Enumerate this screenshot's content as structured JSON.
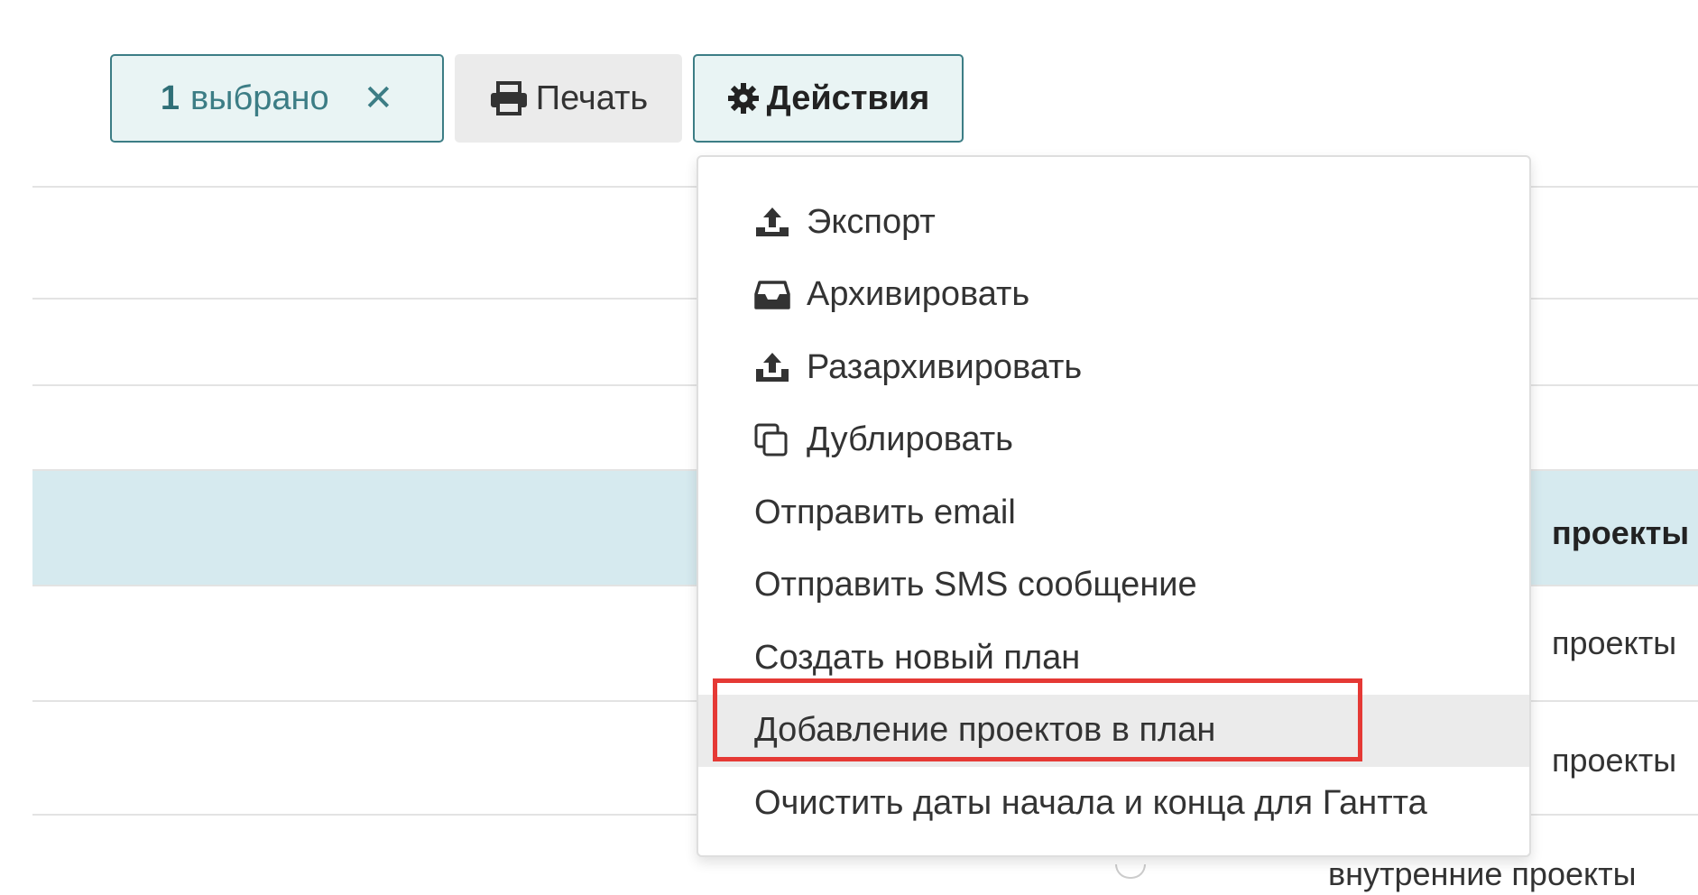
{
  "toolbar": {
    "selected_count": "1",
    "selected_label": "выбрано",
    "clear_glyph": "✕",
    "print_label": "Печать",
    "actions_label": "Действия",
    "accent_color": "#3c7d85"
  },
  "table": {
    "visible_cells": [
      "проекты",
      "проекты",
      "проекты",
      "внутренние проекты"
    ]
  },
  "actions_menu": {
    "items": [
      {
        "label": "Экспорт",
        "icon": "upload-tray-icon"
      },
      {
        "label": "Архивировать",
        "icon": "inbox-icon"
      },
      {
        "label": "Разархивировать",
        "icon": "upload-tray-icon"
      },
      {
        "label": "Дублировать",
        "icon": "copy-icon"
      },
      {
        "label": "Отправить email",
        "icon": ""
      },
      {
        "label": "Отправить SMS сообщение",
        "icon": ""
      },
      {
        "label": "Создать новый план",
        "icon": ""
      },
      {
        "label": "Добавление проектов в план",
        "icon": "",
        "hovered": true
      },
      {
        "label": "Очистить даты начала и конца для Гантта",
        "icon": ""
      }
    ],
    "annotation_color": "#e53935"
  }
}
